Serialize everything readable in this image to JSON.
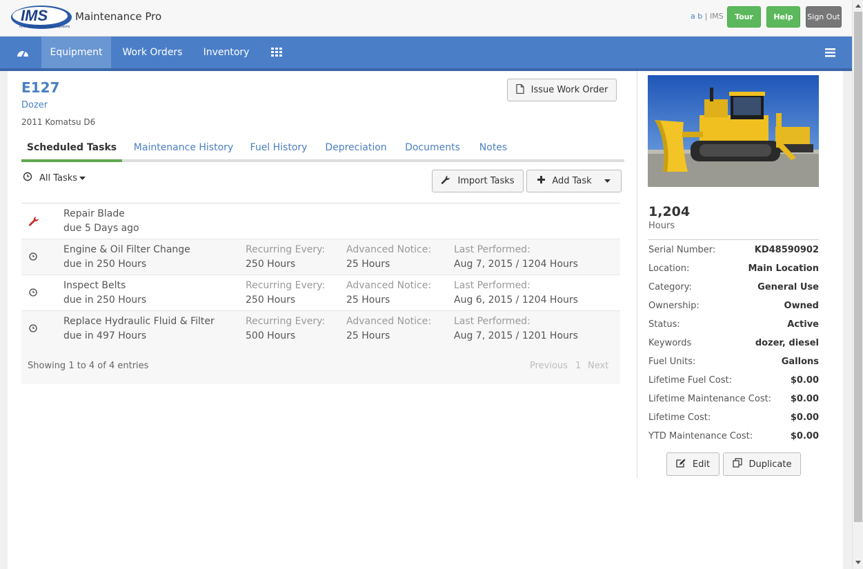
{
  "app": {
    "logo_text": "IMS",
    "logo_sub": "Innovative Maintenance Systems",
    "title": "Maintenance Pro",
    "user_initials": "a b",
    "user_company": "IMS",
    "tour_label": "Tour",
    "help_label": "Help",
    "signout_label": "Sign Out"
  },
  "nav": {
    "items": [
      {
        "label": "Equipment"
      },
      {
        "label": "Work Orders"
      },
      {
        "label": "Inventory"
      }
    ]
  },
  "equipment": {
    "id": "E127",
    "type": "Dozer",
    "model": "2011 Komatsu D6",
    "issue_wo_label": "Issue Work Order"
  },
  "tabs": [
    {
      "label": "Scheduled Tasks"
    },
    {
      "label": "Maintenance History"
    },
    {
      "label": "Fuel History"
    },
    {
      "label": "Depreciation"
    },
    {
      "label": "Documents"
    },
    {
      "label": "Notes"
    }
  ],
  "tasks_toolbar": {
    "filter_label": "All Tasks",
    "import_label": "Import Tasks",
    "add_label": "Add Task"
  },
  "columns": {
    "recurring": "Recurring Every:",
    "notice": "Advanced Notice:",
    "last": "Last Performed:"
  },
  "tasks": [
    {
      "name": "Repair Blade",
      "due": "due 5 Days ago",
      "recurring": "",
      "notice": "",
      "last": "",
      "icon": "wrench-icon"
    },
    {
      "name": "Engine & Oil Filter Change",
      "due": "due in 250 Hours",
      "recurring": "250 Hours",
      "notice": "25 Hours",
      "last": "Aug 7, 2015 / 1204 Hours",
      "icon": "clock-icon"
    },
    {
      "name": "Inspect Belts",
      "due": "due in 250 Hours",
      "recurring": "250 Hours",
      "notice": "25 Hours",
      "last": "Aug 6, 2015 / 1204 Hours",
      "icon": "clock-icon"
    },
    {
      "name": "Replace Hydraulic Fluid & Filter",
      "due": "due in 497 Hours",
      "recurring": "500 Hours",
      "notice": "25 Hours",
      "last": "Aug 7, 2015 / 1201 Hours",
      "icon": "clock-icon"
    }
  ],
  "table_footer": {
    "showing": "Showing 1 to 4 of 4 entries",
    "previous": "Previous",
    "page": "1",
    "next": "Next"
  },
  "sidebar": {
    "hours_value": "1,204",
    "hours_label": "Hours",
    "properties": [
      {
        "key": "Serial Number:",
        "value": "KD48590902"
      },
      {
        "key": "Location:",
        "value": "Main Location"
      },
      {
        "key": "Category:",
        "value": "General Use"
      },
      {
        "key": "Ownership:",
        "value": "Owned"
      },
      {
        "key": "Status:",
        "value": "Active"
      },
      {
        "key": "Keywords",
        "value": "dozer, diesel"
      },
      {
        "key": "Fuel Units:",
        "value": "Gallons"
      },
      {
        "key": "Lifetime Fuel Cost:",
        "value": "$0.00"
      },
      {
        "key": "Lifetime Maintenance Cost:",
        "value": "$0.00"
      },
      {
        "key": "Lifetime Cost:",
        "value": "$0.00"
      },
      {
        "key": "YTD Maintenance Cost:",
        "value": "$0.00"
      }
    ],
    "edit_label": "Edit",
    "duplicate_label": "Duplicate"
  },
  "colors": {
    "nav": "#4a7ec7",
    "link": "#4a7fc1",
    "success": "#5cb85c",
    "tab_active": "#5fa84f",
    "danger": "#c9302c"
  }
}
